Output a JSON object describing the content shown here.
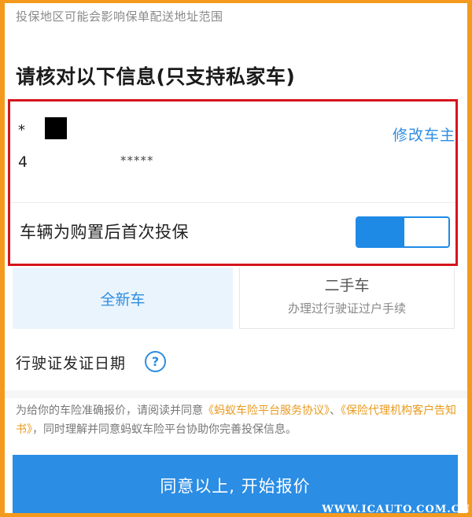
{
  "top_note": "投保地区可能会影响保单配送地址范围",
  "section_title": "请核对以下信息(只支持私家车)",
  "owner": {
    "name_prefix": "*",
    "edit_label": "修改车主",
    "plate_prefix": "4",
    "plate_mask": "*****"
  },
  "first_insurance": {
    "label": "车辆为购置后首次投保",
    "toggle_on_fraction": 0.52
  },
  "car_type": {
    "new_label": "全新车",
    "used_label": "二手车",
    "used_hint": "办理过行驶证过户手续"
  },
  "license_date": {
    "label": "行驶证发证日期",
    "help_glyph": "?"
  },
  "agreement": {
    "pre": "为给你的车险准确报价，请阅读并同意",
    "link1": "《蚂蚁车险平台服务协议》",
    "sep": "、",
    "link2": "《保险代理机构客户告知书》",
    "post": "，同时理解并同意蚂蚁车险平台协助你完善投保信息。"
  },
  "start_button": "同意以上, 开始报价",
  "watermark": "WWW.ICAUTO.COM.CN",
  "colors": {
    "accent": "#2d8de0",
    "highlight_border": "#d4141c",
    "link": "#e89a1e",
    "frame": "#f39a1e"
  }
}
